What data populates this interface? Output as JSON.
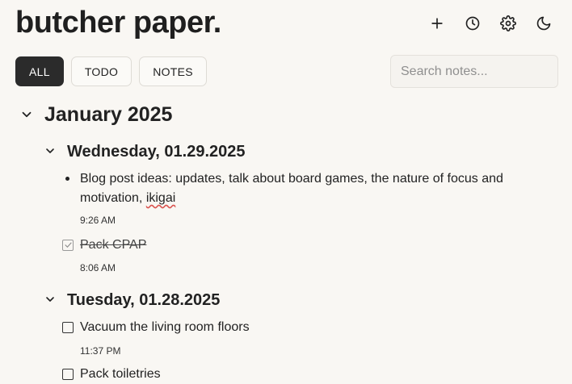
{
  "app": {
    "title": "butcher paper."
  },
  "toolbar": {
    "icons": [
      "plus-icon",
      "clock-icon",
      "gear-icon",
      "moon-icon"
    ]
  },
  "filters": [
    {
      "label": "ALL",
      "active": true
    },
    {
      "label": "TODO",
      "active": false
    },
    {
      "label": "NOTES",
      "active": false
    }
  ],
  "search": {
    "placeholder": "Search notes...",
    "value": ""
  },
  "month": {
    "title": "January 2025"
  },
  "days": [
    {
      "title": "Wednesday, 01.29.2025",
      "entries": [
        {
          "type": "note",
          "text_line1": "Blog post ideas: updates, talk about board games, the nature of focus and",
          "text_line2_prefix": "motivation, ",
          "text_line2_flagged": "ikigai",
          "time": "9:26 AM"
        },
        {
          "type": "todo",
          "checked": true,
          "text": "Pack CPAP",
          "time": "8:06 AM"
        }
      ]
    },
    {
      "title": "Tuesday, 01.28.2025",
      "entries": [
        {
          "type": "todo",
          "checked": false,
          "text": "Vacuum the living room floors",
          "time": "11:37 PM"
        },
        {
          "type": "todo",
          "checked": false,
          "text": "Pack toiletries"
        }
      ]
    }
  ]
}
